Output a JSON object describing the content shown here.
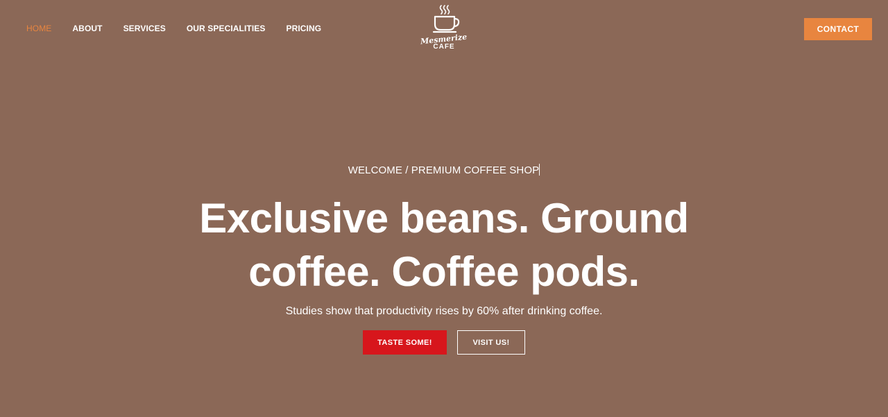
{
  "nav": {
    "items": [
      {
        "label": "HOME",
        "active": true
      },
      {
        "label": "ABOUT",
        "active": false
      },
      {
        "label": "SERVICES",
        "active": false
      },
      {
        "label": "OUR SPECIALITIES",
        "active": false
      },
      {
        "label": "PRICING",
        "active": false
      }
    ]
  },
  "logo": {
    "icon": "coffee-cup-icon",
    "script_text": "Mesmerize",
    "word": "CAFE"
  },
  "header": {
    "contact_label": "CONTACT"
  },
  "hero": {
    "subtitle": "WELCOME / PREMIUM COFFEE SHOP",
    "title_line1": "Exclusive beans. Ground",
    "title_line2": "coffee. Coffee pods.",
    "description": "Studies show that productivity rises by 60% after drinking coffee.",
    "primary_button": "TASTE SOME!",
    "secondary_button": "VISIT US!"
  },
  "colors": {
    "background": "#8b6857",
    "accent": "#e8853f",
    "primary_button": "#d7161c",
    "text": "#ffffff"
  }
}
